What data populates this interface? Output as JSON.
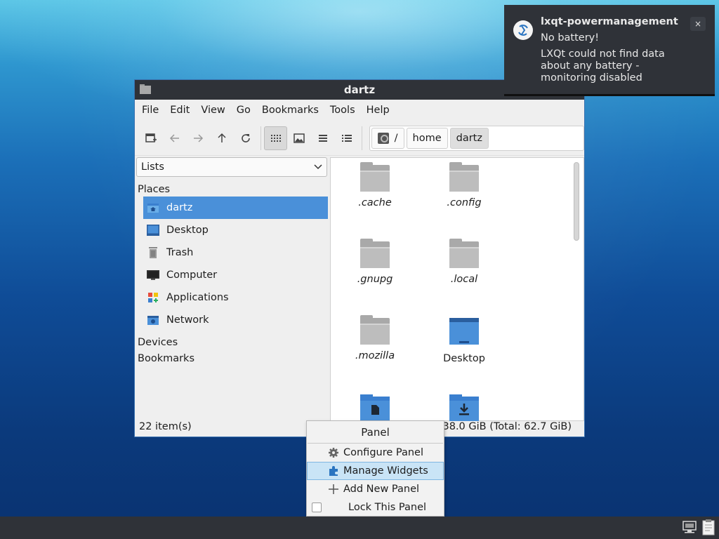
{
  "window": {
    "title": "dartz"
  },
  "menubar": [
    "File",
    "Edit",
    "View",
    "Go",
    "Bookmarks",
    "Tools",
    "Help"
  ],
  "toolbar": {
    "buttons": [
      "new-tab",
      "back",
      "forward",
      "up",
      "reload",
      "icon-view",
      "thumbnail-view",
      "compact-view",
      "detailed-list-view"
    ]
  },
  "path": {
    "crumbs": [
      "/",
      "home",
      "dartz"
    ]
  },
  "sidebar": {
    "mode": "Lists",
    "places_label": "Places",
    "places": [
      {
        "label": "dartz",
        "icon": "home-folder-icon",
        "selected": true
      },
      {
        "label": "Desktop",
        "icon": "desktop-icon",
        "selected": false
      },
      {
        "label": "Trash",
        "icon": "trash-icon",
        "selected": false
      },
      {
        "label": "Computer",
        "icon": "computer-icon",
        "selected": false
      },
      {
        "label": "Applications",
        "icon": "applications-icon",
        "selected": false
      },
      {
        "label": "Network",
        "icon": "network-icon",
        "selected": false
      }
    ],
    "devices_label": "Devices",
    "bookmarks_label": "Bookmarks"
  },
  "files": [
    {
      "name": ".cache",
      "icon": "folder-icon"
    },
    {
      "name": ".config",
      "icon": "folder-icon"
    },
    {
      "name": ".gnupg",
      "icon": "folder-icon"
    },
    {
      "name": ".local",
      "icon": "folder-icon"
    },
    {
      "name": ".mozilla",
      "icon": "folder-icon"
    },
    {
      "name": "Desktop",
      "icon": "desktop-folder-icon"
    },
    {
      "name": "",
      "icon": "documents-folder-icon"
    },
    {
      "name": "",
      "icon": "downloads-folder-icon"
    }
  ],
  "statusbar": {
    "items": "22 item(s)",
    "space": "e: 38.0 GiB (Total: 62.7 GiB)"
  },
  "context_menu": {
    "title": "Panel",
    "items": [
      {
        "label": "Configure Panel",
        "icon": "gear-icon"
      },
      {
        "label": "Manage Widgets",
        "icon": "puzzle-icon",
        "hover": true
      },
      {
        "label": "Add New Panel",
        "icon": "plus-icon"
      },
      {
        "label": "Lock This Panel",
        "icon": "checkbox"
      }
    ]
  },
  "notification": {
    "app": "lxqt-powermanagement",
    "summary": "No battery!",
    "body": "LXQt could not find data about any battery - monitoring disabled",
    "close": "×"
  },
  "colors": {
    "selection": "#4a90d9",
    "titlebar": "#2f3238",
    "menu_hover": "#c9e4f6"
  }
}
